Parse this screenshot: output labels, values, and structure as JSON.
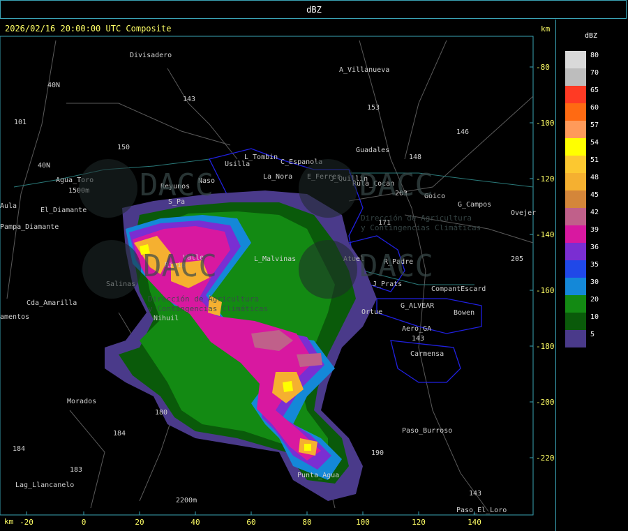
{
  "header": {
    "product": "dBZ",
    "timestamp": "2026/02/16 20:00:00 UTC Composite",
    "km_unit_top": "km",
    "km_unit_bottom": "km"
  },
  "axes": {
    "x_ticks": [
      "-20",
      "0",
      "20",
      "40",
      "60",
      "80",
      "100",
      "120",
      "140"
    ],
    "y_ticks": [
      "-80",
      "-100",
      "-120",
      "-140",
      "-160",
      "-180",
      "-200",
      "-220"
    ]
  },
  "legend": {
    "title": "dBZ",
    "items": [
      {
        "label": "80",
        "color": "#d9d9d9"
      },
      {
        "label": "70",
        "color": "#bdbdbd"
      },
      {
        "label": "65",
        "color": "#ff3a24"
      },
      {
        "label": "60",
        "color": "#ff6a12"
      },
      {
        "label": "57",
        "color": "#ff9a5a"
      },
      {
        "label": "54",
        "color": "#ffff00"
      },
      {
        "label": "51",
        "color": "#fcc830"
      },
      {
        "label": "48",
        "color": "#f5b030"
      },
      {
        "label": "45",
        "color": "#d4863a"
      },
      {
        "label": "42",
        "color": "#c0608a"
      },
      {
        "label": "39",
        "color": "#d818a0"
      },
      {
        "label": "36",
        "color": "#7a2ed2"
      },
      {
        "label": "35",
        "color": "#2048e8"
      },
      {
        "label": "30",
        "color": "#1488d8"
      },
      {
        "label": "20",
        "color": "#138a13"
      },
      {
        "label": "10",
        "color": "#0a5a0a"
      },
      {
        "label": "5",
        "color": "#4a3a8a"
      }
    ]
  },
  "watermarks": [
    "DACC",
    "DACC",
    "DACC",
    "DACC"
  ],
  "watermark_subtitles": [
    "Dirección de Agricultura",
    "y Contingencias Climáticas"
  ],
  "places": [
    {
      "name": "Divisadero"
    },
    {
      "name": "A_Villanueva"
    },
    {
      "name": "40N"
    },
    {
      "name": "143"
    },
    {
      "name": "153"
    },
    {
      "name": "101"
    },
    {
      "name": "146"
    },
    {
      "name": "150"
    },
    {
      "name": "L_Tombin"
    },
    {
      "name": "Usilla"
    },
    {
      "name": "C_Espanola"
    },
    {
      "name": "Guadales"
    },
    {
      "name": "148"
    },
    {
      "name": "40N"
    },
    {
      "name": "Agua_Toro"
    },
    {
      "name": "1500m"
    },
    {
      "name": "La_Nora"
    },
    {
      "name": "E_Ferrer"
    },
    {
      "name": "J_Quillin"
    },
    {
      "name": "Ruta_Cocan"
    },
    {
      "name": "Reyunos"
    },
    {
      "name": "Naso"
    },
    {
      "name": "203"
    },
    {
      "name": "Goico"
    },
    {
      "name": "G_Campos"
    },
    {
      "name": "Aula"
    },
    {
      "name": "El_Diamante"
    },
    {
      "name": "S_Pa"
    },
    {
      "name": "Ovejer"
    },
    {
      "name": "Pampa_Diamante"
    },
    {
      "name": "171"
    },
    {
      "name": "R_Padre"
    },
    {
      "name": "205"
    },
    {
      "name": "Valle"
    },
    {
      "name": "Rivio"
    },
    {
      "name": "L_Malvinas"
    },
    {
      "name": "Atuel"
    },
    {
      "name": "Salinas"
    },
    {
      "name": "J_Prats"
    },
    {
      "name": "CompantEscard"
    },
    {
      "name": "Cda_Amarilla"
    },
    {
      "name": "G_ALVEAR"
    },
    {
      "name": "Bowen"
    },
    {
      "name": "amentos"
    },
    {
      "name": "Nihuil"
    },
    {
      "name": "Ortue"
    },
    {
      "name": "Aero_GA"
    },
    {
      "name": "143"
    },
    {
      "name": "Carmensa"
    },
    {
      "name": "Morados"
    },
    {
      "name": "180"
    },
    {
      "name": "184"
    },
    {
      "name": "184"
    },
    {
      "name": "190"
    },
    {
      "name": "Paso_Burroso"
    },
    {
      "name": "183"
    },
    {
      "name": "Punta_Agua"
    },
    {
      "name": "Lag_Llancanelo"
    },
    {
      "name": "2200m"
    },
    {
      "name": "143"
    },
    {
      "name": "Paso_El_Loro"
    }
  ]
}
